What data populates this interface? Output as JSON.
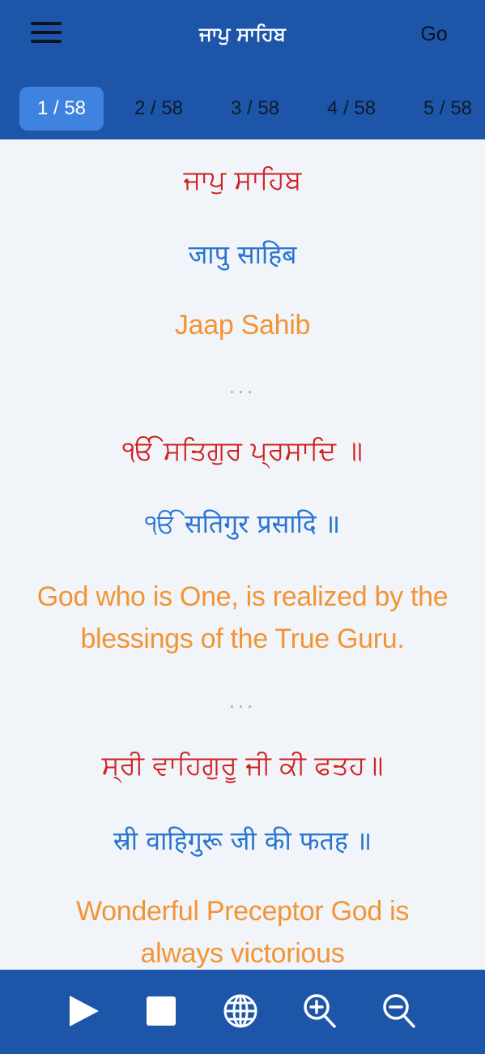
{
  "header": {
    "title": "ਜਾਪੁ ਸਾਹਿਬ",
    "go_label": "Go",
    "tabs": [
      {
        "label": "1 / 58",
        "active": true
      },
      {
        "label": "2 / 58",
        "active": false
      },
      {
        "label": "3 / 58",
        "active": false
      },
      {
        "label": "4 / 58",
        "active": false
      },
      {
        "label": "5 / 58",
        "active": false
      }
    ]
  },
  "content": {
    "verses": [
      {
        "gurmukhi": "ਜਾਪੁ ਸਾਹਿਬ",
        "hindi": "जापु साहिब",
        "english": [
          "Jaap Sahib"
        ]
      },
      {
        "gurmukhi": "ੴ ਸਤਿਗੁਰ ਪ੍ਰਸਾਦਿ ॥",
        "hindi": "ੴ सतिगुर प्रसादि ॥",
        "english": [
          "God who is One, is realized by the",
          "blessings of the True Guru."
        ]
      },
      {
        "gurmukhi": "ਸ੍ਰੀ ਵਾਹਿਗੁਰੂ ਜੀ ਕੀ ਫਤਹ॥",
        "hindi": "स्री वाहिगुरू जी की फतह ॥",
        "english": [
          "Wonderful Preceptor God is",
          "always victorious"
        ]
      }
    ],
    "separator": "..."
  },
  "footer": {
    "buttons": [
      "play-icon",
      "stop-icon",
      "globe-icon",
      "zoom-in-icon",
      "zoom-out-icon"
    ]
  },
  "colors": {
    "header_bg": "#1d56a8",
    "active_tab": "#3d83df",
    "gurmukhi": "#d01f1f",
    "hindi": "#2a74d1",
    "english": "#f39434",
    "content_bg": "#f1f5fa"
  }
}
